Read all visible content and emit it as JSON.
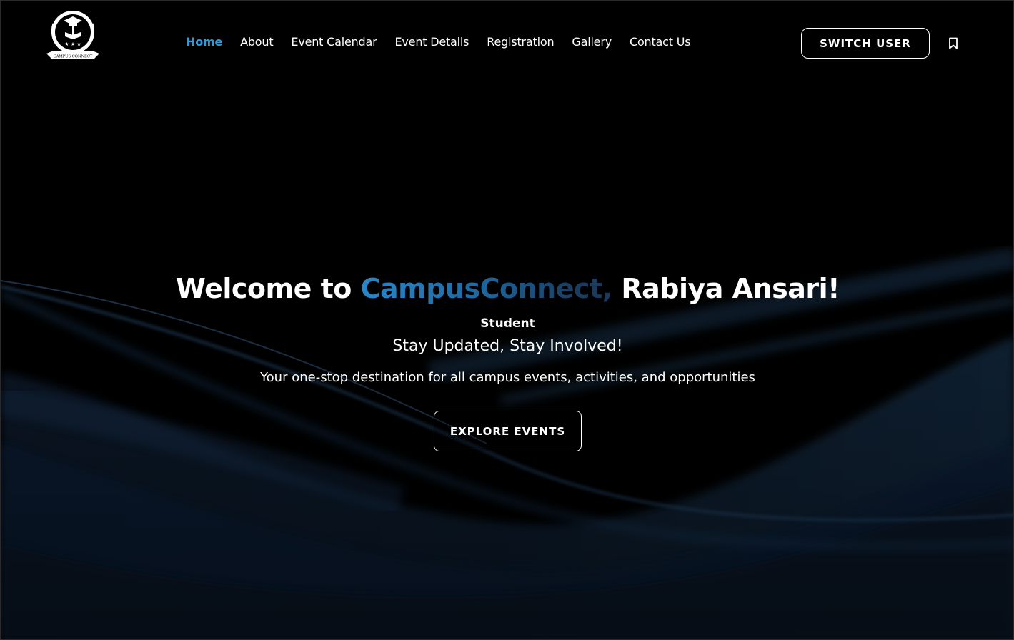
{
  "header": {
    "logo_text": "CAMPUS CONNECT",
    "nav": [
      {
        "label": "Home",
        "active": true
      },
      {
        "label": "About",
        "active": false
      },
      {
        "label": "Event Calendar",
        "active": false
      },
      {
        "label": "Event Details",
        "active": false
      },
      {
        "label": "Registration",
        "active": false
      },
      {
        "label": "Gallery",
        "active": false
      },
      {
        "label": "Contact Us",
        "active": false
      }
    ],
    "switch_user_label": "SWITCH USER",
    "bookmark_icon": "bookmark-icon"
  },
  "hero": {
    "welcome_prefix": "Welcome to ",
    "brand": "CampusConnect,",
    "user_name": " Rabiya Ansari!",
    "role": "Student",
    "tagline": "Stay Updated, Stay Involved!",
    "description": "Your one-stop destination for all campus events, activities, and opportunities",
    "cta_label": "EXPLORE EVENTS"
  },
  "colors": {
    "background": "#000000",
    "accent": "#2a9de0",
    "wave": "#1e3f66"
  }
}
